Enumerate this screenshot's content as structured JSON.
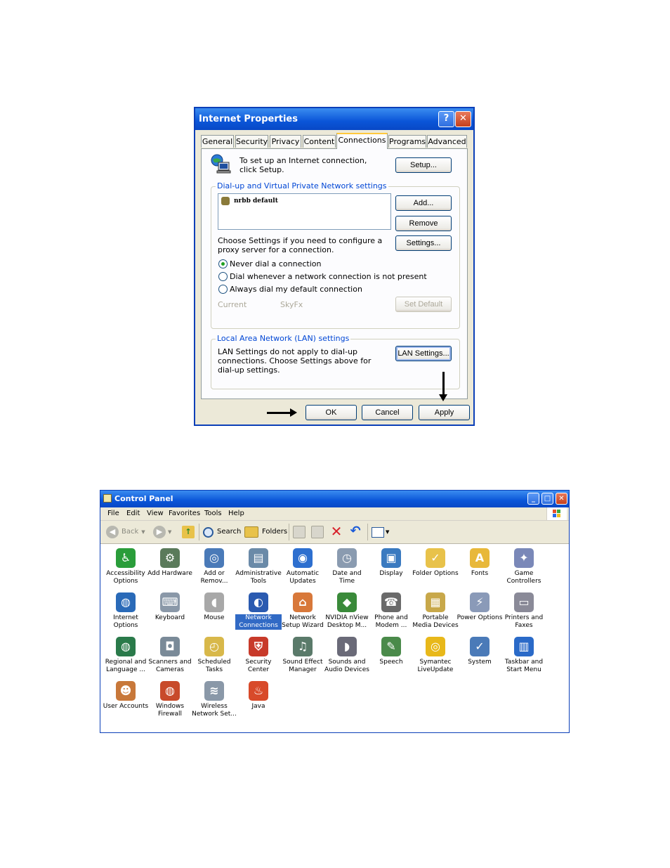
{
  "internet_properties": {
    "title": "Internet Properties",
    "help_glyph": "?",
    "close_glyph": "✕",
    "tabs": [
      "General",
      "Security",
      "Privacy",
      "Content",
      "Connections",
      "Programs",
      "Advanced"
    ],
    "active_tab": "Connections",
    "setup_text": "To set up an Internet connection, click Setup.",
    "setup_button": "Setup...",
    "dialup_group_title": "Dial-up and Virtual Private Network settings",
    "connections_list": [
      "nrbb default"
    ],
    "add_button": "Add...",
    "remove_button": "Remove",
    "proxy_text": "Choose Settings if you need to configure a proxy server for a connection.",
    "settings_button": "Settings...",
    "radio_options": [
      "Never dial a connection",
      "Dial whenever a network connection is not present",
      "Always dial my default connection"
    ],
    "selected_radio": 0,
    "current_label": "Current",
    "current_value": "SkyFx",
    "set_default_button": "Set Default",
    "lan_group_title": "Local Area Network (LAN) settings",
    "lan_text": "LAN Settings do not apply to dial-up connections. Choose Settings above for dial-up settings.",
    "lan_settings_button": "LAN Settings...",
    "ok_button": "OK",
    "cancel_button": "Cancel",
    "apply_button": "Apply"
  },
  "control_panel": {
    "title": "Control Panel",
    "min_glyph": "_",
    "max_glyph": "□",
    "close_glyph": "✕",
    "menu": [
      "File",
      "Edit",
      "View",
      "Favorites",
      "Tools",
      "Help"
    ],
    "toolbar": {
      "back": "Back",
      "search": "Search",
      "folders": "Folders"
    },
    "items": [
      {
        "label": "Accessibility Options",
        "icon": "accessibility-icon",
        "color": "#2a9d3a",
        "glyph": "♿"
      },
      {
        "label": "Add Hardware",
        "icon": "hardware-icon",
        "color": "#5a7a5a",
        "glyph": "⚙"
      },
      {
        "label": "Add or Remov...",
        "icon": "add-remove-icon",
        "color": "#4a7ab8",
        "glyph": "◎"
      },
      {
        "label": "Administrative Tools",
        "icon": "admin-tools-icon",
        "color": "#6a8aa8",
        "glyph": "▤"
      },
      {
        "label": "Automatic Updates",
        "icon": "updates-icon",
        "color": "#2d6fcf",
        "glyph": "◉"
      },
      {
        "label": "Date and Time",
        "icon": "clock-icon",
        "color": "#8a9bb0",
        "glyph": "◷"
      },
      {
        "label": "Display",
        "icon": "display-icon",
        "color": "#3a7ac0",
        "glyph": "▣"
      },
      {
        "label": "Folder Options",
        "icon": "folder-icon",
        "color": "#e8c24a",
        "glyph": "✓"
      },
      {
        "label": "Fonts",
        "icon": "fonts-icon",
        "color": "#e8b83a",
        "glyph": "A"
      },
      {
        "label": "Game Controllers",
        "icon": "gamepad-icon",
        "color": "#7a88b8",
        "glyph": "✦"
      },
      {
        "label": "Internet Options",
        "icon": "globe-icon",
        "color": "#2a6ab8",
        "glyph": "◍"
      },
      {
        "label": "Keyboard",
        "icon": "keyboard-icon",
        "color": "#8a98a8",
        "glyph": "⌨"
      },
      {
        "label": "Mouse",
        "icon": "mouse-icon",
        "color": "#a8a8a8",
        "glyph": "◖"
      },
      {
        "label": "Network Connections",
        "icon": "network-icon",
        "color": "#2a5ab0",
        "glyph": "◐"
      },
      {
        "label": "Network Setup Wizard",
        "icon": "house-icon",
        "color": "#d8783a",
        "glyph": "⌂"
      },
      {
        "label": "NVIDIA nView Desktop M...",
        "icon": "nvidia-icon",
        "color": "#3a8a3a",
        "glyph": "◆"
      },
      {
        "label": "Phone and Modem ...",
        "icon": "phone-icon",
        "color": "#6a6a6a",
        "glyph": "☎"
      },
      {
        "label": "Portable Media Devices",
        "icon": "media-device-icon",
        "color": "#c8a84a",
        "glyph": "▦"
      },
      {
        "label": "Power Options",
        "icon": "power-icon",
        "color": "#8a9ab8",
        "glyph": "⚡"
      },
      {
        "label": "Printers and Faxes",
        "icon": "printer-icon",
        "color": "#8a8a98",
        "glyph": "▭"
      },
      {
        "label": "Regional and Language ...",
        "icon": "globe-regional-icon",
        "color": "#2a7a4a",
        "glyph": "◍"
      },
      {
        "label": "Scanners and Cameras",
        "icon": "scanner-icon",
        "color": "#7a8a98",
        "glyph": "◘"
      },
      {
        "label": "Scheduled Tasks",
        "icon": "scheduled-tasks-icon",
        "color": "#d8b84a",
        "glyph": "◴"
      },
      {
        "label": "Security Center",
        "icon": "shield-icon",
        "color": "#c83a2a",
        "glyph": "⛨"
      },
      {
        "label": "Sound Effect Manager",
        "icon": "sound-manager-icon",
        "color": "#5a7a6a",
        "glyph": "♫"
      },
      {
        "label": "Sounds and Audio Devices",
        "icon": "speaker-icon",
        "color": "#6a6a78",
        "glyph": "◗"
      },
      {
        "label": "Speech",
        "icon": "speech-icon",
        "color": "#4a8a4a",
        "glyph": "✎"
      },
      {
        "label": "Symantec LiveUpdate",
        "icon": "liveupdate-icon",
        "color": "#e8b81a",
        "glyph": "◎"
      },
      {
        "label": "System",
        "icon": "system-icon",
        "color": "#4a7ab8",
        "glyph": "✓"
      },
      {
        "label": "Taskbar and Start Menu",
        "icon": "taskbar-icon",
        "color": "#2a6ac8",
        "glyph": "▥"
      },
      {
        "label": "User Accounts",
        "icon": "users-icon",
        "color": "#c8783a",
        "glyph": "☻"
      },
      {
        "label": "Windows Firewall",
        "icon": "firewall-icon",
        "color": "#c84a2a",
        "glyph": "◍"
      },
      {
        "label": "Wireless Network Set...",
        "icon": "wireless-icon",
        "color": "#8a98a8",
        "glyph": "≋"
      },
      {
        "label": "Java",
        "icon": "java-icon",
        "color": "#d84a2a",
        "glyph": "♨"
      }
    ],
    "selected_item": "Network Connections"
  }
}
